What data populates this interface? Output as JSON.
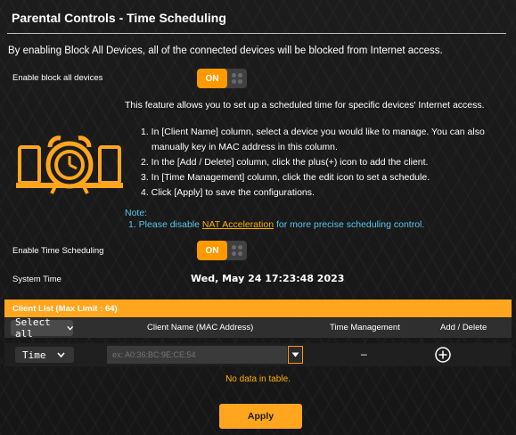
{
  "title": "Parental Controls - Time Scheduling",
  "description": "By enabling Block All Devices, all of the connected devices will be blocked from Internet access.",
  "block_all": {
    "label": "Enable block all devices",
    "toggle_label": "ON"
  },
  "feature_text": "This feature allows you to set up a scheduled time for specific devices' Internet access.",
  "steps": [
    "1. In [Client Name] column, select a device you would like to manage. You can also",
    "manually key in MAC address in this column.",
    "2. In the [Add / Delete] column, click the plus(+) icon to add the client.",
    "3. In [Time Management] column, click the edit icon to set a schedule.",
    "4. Click [Apply] to save the configurations."
  ],
  "note": {
    "heading": "Note:",
    "prefix": "1. Please disable ",
    "link": "NAT Acceleration",
    "suffix": " for more precise scheduling control."
  },
  "time_scheduling": {
    "label": "Enable Time Scheduling",
    "toggle_label": "ON"
  },
  "system_time": {
    "label": "System Time",
    "value": "Wed, May 24 17:23:48 2023"
  },
  "client_list": {
    "header": "Client List (Max Limit : 64)",
    "select_all": "Select all",
    "columns": {
      "client_name": "Client Name (MAC Address)",
      "time_management": "Time Management",
      "add_delete": "Add / Delete"
    },
    "new_row": {
      "type_value": "Time",
      "mac_placeholder": "ex: A0:36:BC:9E:CE:54",
      "time_management_value": "–"
    },
    "empty_text": "No data in table."
  },
  "apply_label": "Apply",
  "colors": {
    "accent": "#ffa61e",
    "note": "#5cc6ea",
    "link": "#ffb100"
  },
  "icons": [
    "alarm-clock-laptop-illustration",
    "chevron-down-icon",
    "plus-circle-icon"
  ]
}
